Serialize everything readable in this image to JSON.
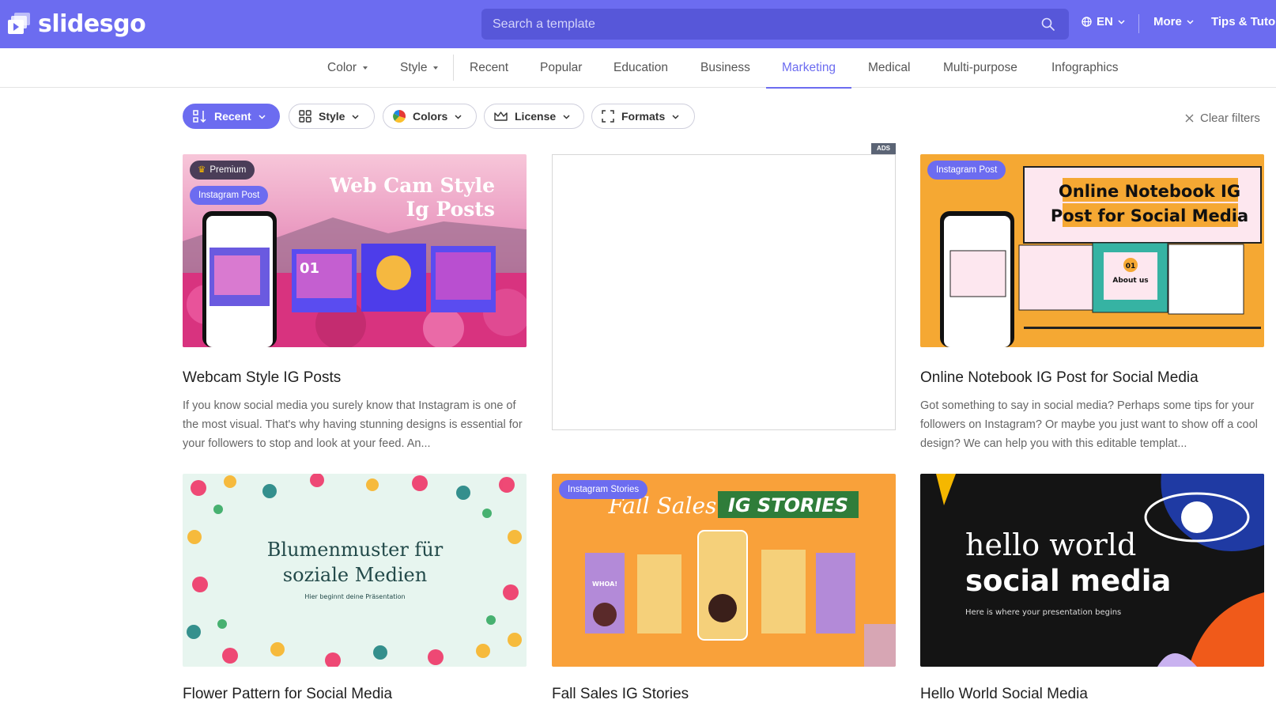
{
  "brand": {
    "name": "slidesgo"
  },
  "search": {
    "placeholder": "Search a template"
  },
  "topnav": {
    "lang": "EN",
    "more": "More",
    "tips": "Tips & Tuto"
  },
  "categories": [
    {
      "label": "Color",
      "dropdown": true
    },
    {
      "label": "Style",
      "dropdown": true
    },
    {
      "label": "Recent"
    },
    {
      "label": "Popular"
    },
    {
      "label": "Education"
    },
    {
      "label": "Business"
    },
    {
      "label": "Marketing",
      "active": true
    },
    {
      "label": "Medical"
    },
    {
      "label": "Multi-purpose"
    },
    {
      "label": "Infographics"
    }
  ],
  "filters": {
    "sort": "Recent",
    "style": "Style",
    "colors": "Colors",
    "license": "License",
    "formats": "Formats",
    "clear": "Clear filters"
  },
  "ads_label": "ADS",
  "cards": [
    {
      "title": "Webcam Style IG Posts",
      "description": "If you know social media you surely know that Instagram is one of the most visual. That's why having stunning designs is essential for your followers to stop and look at your feed. An...",
      "badges": [
        "Premium",
        "Instagram Post"
      ],
      "thumb_text": [
        "Web Cam Style",
        "Ig Posts",
        "01"
      ]
    },
    {
      "title": "Online Notebook IG Post for Social Media",
      "description": "Got something to say in social media? Perhaps some tips for your followers on Instagram? Or maybe you just want to show off a cool design? We can help you with this editable templat...",
      "badges": [
        "Instagram Post"
      ],
      "thumb_text": [
        "Online Notebook IG",
        "Post for Social Media",
        "01",
        "About us"
      ]
    },
    {
      "title": "Flower Pattern for Social Media",
      "badges": [],
      "thumb_text": [
        "Blumenmuster für",
        "soziale Medien",
        "Hier beginnt deine Präsentation"
      ]
    },
    {
      "title": "Fall Sales IG Stories",
      "badges": [
        "Instagram Stories"
      ],
      "thumb_text": [
        "Fall Sales",
        "IG STORIES",
        "WHOA!"
      ]
    },
    {
      "title": "Hello World Social Media",
      "badges": [],
      "thumb_text": [
        "hello world",
        "social media",
        "Here is where your presentation begins"
      ]
    }
  ],
  "colors": {
    "brand": "#6c6cf0",
    "searchbg": "#5757d9"
  }
}
